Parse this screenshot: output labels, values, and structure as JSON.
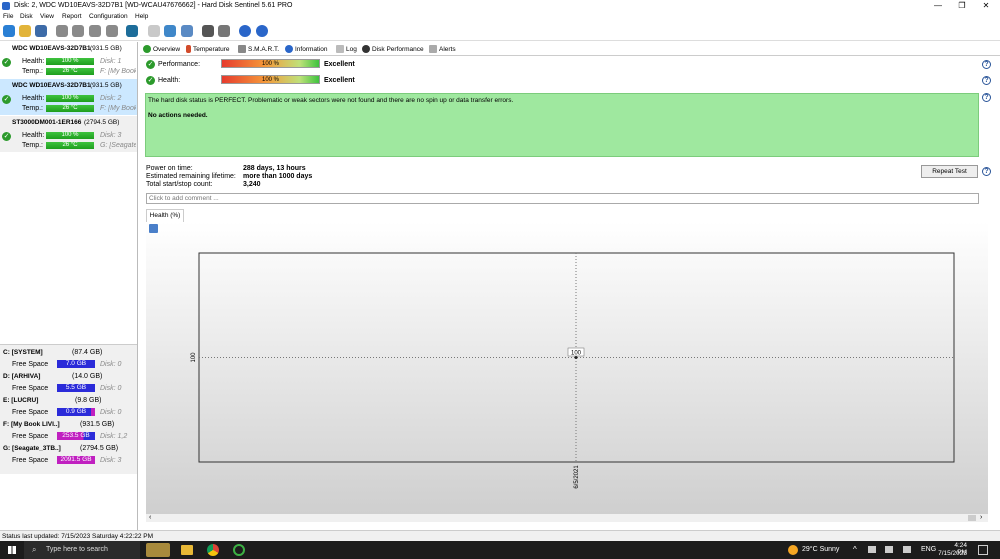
{
  "window": {
    "title": "Disk: 2, WDC WD10EAVS-32D7B1 [WD-WCAU47676662]  -  Hard Disk Sentinel 5.61 PRO",
    "minimize": "—",
    "maximize": "❐",
    "close": "✕"
  },
  "menu": [
    "File",
    "Disk",
    "View",
    "Report",
    "Configuration",
    "Help"
  ],
  "disks": [
    {
      "name": "WDC WD10EAVS-32D7B1",
      "size": "(931.5 GB)",
      "health_label": "Health:",
      "health": "100 %",
      "temp_label": "Temp.:",
      "temp": "26 °C",
      "disk": "Disk: 1",
      "vol": "F: [My Book L"
    },
    {
      "name": "WDC WD10EAVS-32D7B1",
      "size": "(931.5 GB)",
      "health_label": "Health:",
      "health": "100 %",
      "temp_label": "Temp.:",
      "temp": "26 °C",
      "disk": "Disk: 2",
      "vol": "F: [My Book L"
    },
    {
      "name": "ST3000DM001-1ER166",
      "size": "(2794.5 GB)",
      "health_label": "Health:",
      "health": "100 %",
      "temp_label": "Temp.:",
      "temp": "26 °C",
      "disk": "Disk: 3",
      "vol": "G: [Seagate_3"
    }
  ],
  "volumes": [
    {
      "name": "C: [SYSTEM]",
      "size": "(87.4 GB)",
      "free_label": "Free Space",
      "free": "7.0 GB",
      "disk": "Disk: 0",
      "color": "#2b2bd9"
    },
    {
      "name": "D: [ARHIVA]",
      "size": "(14.0 GB)",
      "free_label": "Free Space",
      "free": "5.5 GB",
      "disk": "Disk: 0",
      "color": "#2b2bd9"
    },
    {
      "name": "E: [LUCRU]",
      "size": "(9.8 GB)",
      "free_label": "Free Space",
      "free": "0.9 GB",
      "disk": "Disk: 0",
      "color": "#c020c0"
    },
    {
      "name": "F: [My Book LIVI..]",
      "size": "(931.5 GB)",
      "free_label": "Free Space",
      "free": "253.5 GB",
      "disk": "Disk: 1,2",
      "color": "#c020c0"
    },
    {
      "name": "G: [Seagate_3TB..]",
      "size": "(2794.5 GB)",
      "free_label": "Free Space",
      "free": "2091.5 GB",
      "disk": "Disk: 3",
      "color": "#c020c0"
    }
  ],
  "tabs": [
    "Overview",
    "Temperature",
    "S.M.A.R.T.",
    "Information",
    "Log",
    "Disk Performance",
    "Alerts"
  ],
  "overview": {
    "performance_label": "Performance:",
    "performance_value": "100 %",
    "performance_status": "Excellent",
    "health_label": "Health:",
    "health_value": "100 %",
    "health_status": "Excellent",
    "message": "The hard disk status is PERFECT. Problematic or weak sectors were not found and there are no spin up or data transfer errors.",
    "actions": "No actions needed.",
    "power_on_label": "Power on time:",
    "power_on": "288 days, 13 hours",
    "remaining_label": "Estimated remaining lifetime:",
    "remaining": "more than 1000 days",
    "startstop_label": "Total start/stop count:",
    "startstop": "3,240",
    "repeat_test": "Repeat Test",
    "comment_placeholder": "Click to add comment ...",
    "graph_tab": "Health (%)"
  },
  "chart_data": {
    "type": "line",
    "x": [
      "6/5/2021"
    ],
    "series": [
      {
        "values": [
          100
        ]
      }
    ],
    "ylabel_tick": "100",
    "point_label": "100",
    "grid": true
  },
  "status": {
    "text": "Status last updated: 7/15/2023 Saturday 4:22:22 PM"
  },
  "taskbar": {
    "search": "Type here to search",
    "weather": "29°C  Sunny",
    "lang": "ENG",
    "time": "4:24 PM",
    "date": "7/15/2023"
  }
}
